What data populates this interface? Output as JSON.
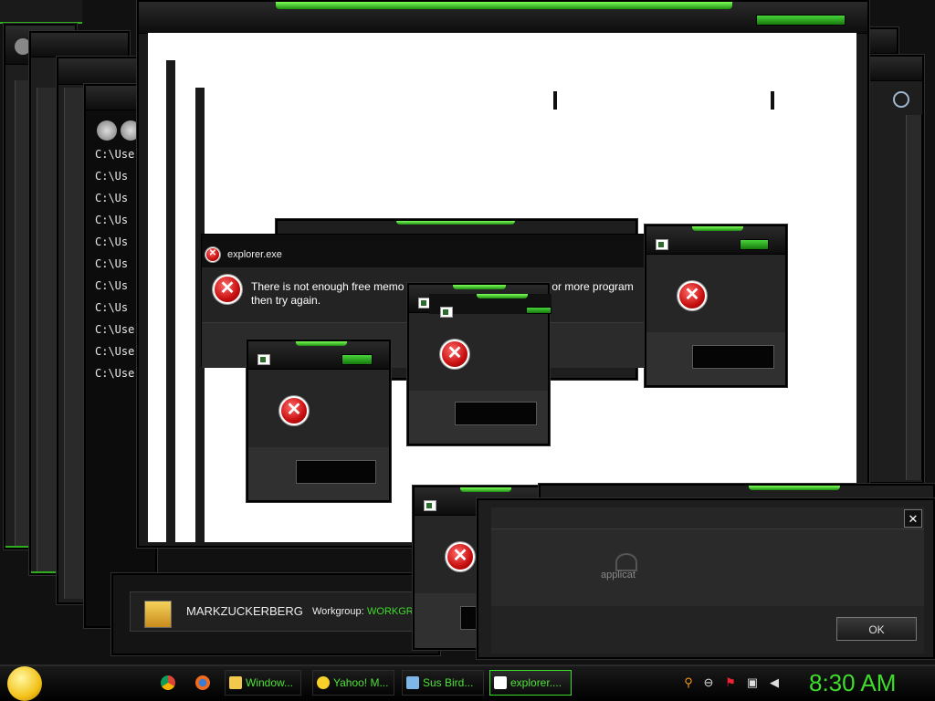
{
  "cmd_lines": [
    "C:\\Use",
    "C:\\Us",
    "C:\\Us",
    "C:\\Us",
    "C:\\Us",
    "C:\\Us",
    "C:\\Us",
    "C:\\Us",
    "C:\\Use",
    "C:\\Use",
    "C:\\Use"
  ],
  "error_dialog": {
    "title": "explorer.exe",
    "message_line1": "There is not enough free memo",
    "message_line1_end": "e one or more program",
    "message_line2": "then try again."
  },
  "error_icon_glyph": "✕",
  "system_panel": {
    "computer_name": "MARKZUCKERBERG",
    "workgroup_label": "Workgroup:",
    "workgroup_value": "WORKGRO"
  },
  "app_dialog": {
    "close_glyph": "✕",
    "icon_text": "applicat",
    "ok_label": "OK"
  },
  "taskbar": {
    "tasks": [
      "Window...",
      "Yahoo! M...",
      "Sus Bird...",
      "explorer...."
    ],
    "clock": "8:30 AM"
  },
  "colors": {
    "accent_green": "#3ddc2a",
    "error_red": "#d21414",
    "window_dark": "#1e1e1e"
  }
}
